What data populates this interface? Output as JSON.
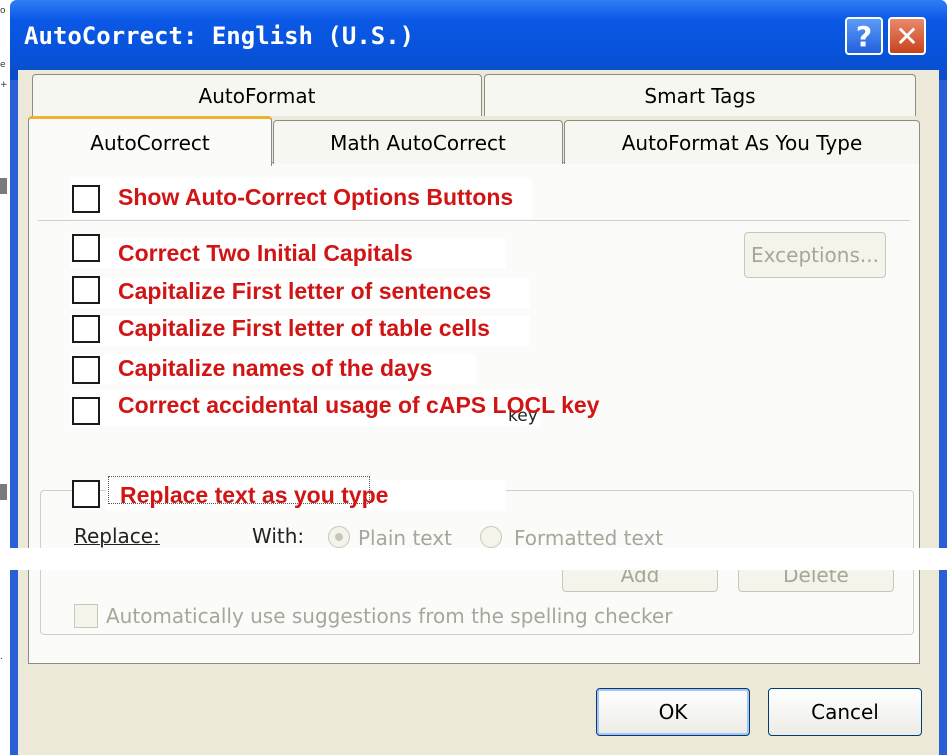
{
  "window": {
    "title": "AutoCorrect: English (U.S.)",
    "help_glyph": "?",
    "close_glyph": "✕"
  },
  "left_scraps": [
    "o",
    "e",
    "+",
    "."
  ],
  "tabs": {
    "row1": [
      "AutoFormat",
      "Smart Tags"
    ],
    "row2": [
      "AutoCorrect",
      "Math AutoCorrect",
      "AutoFormat As You Type"
    ],
    "active": "AutoCorrect"
  },
  "options": [
    {
      "label": "Show Auto-Correct Options Buttons",
      "checked": false
    },
    {
      "label": "Correct Two Initial Capitals",
      "checked": false
    },
    {
      "label": "Capitalize First letter of sentences",
      "checked": false
    },
    {
      "label": "Capitalize First letter of table cells",
      "checked": false
    },
    {
      "label": "Capitalize names of the days",
      "checked": false
    },
    {
      "label": "Correct accidental usage of cAPS LOCL key",
      "checked": false
    },
    {
      "label": "Replace text as you type",
      "checked": false
    }
  ],
  "stray_text": "key",
  "exceptions_label": "Exceptions...",
  "replace_section": {
    "replace_label": "Replace:",
    "with_label": "With:",
    "plain_text": "Plain text",
    "formatted_text": "Formatted text",
    "add_label": "Add",
    "delete_label": "Delete",
    "suggestions_label": "Automatically use suggestions from the spelling checker"
  },
  "footer": {
    "ok_label": "OK",
    "cancel_label": "Cancel"
  },
  "colors": {
    "title_bar": "#0a58e6",
    "annotation_red": "#d11414",
    "dialog_face": "#ece9d8"
  }
}
